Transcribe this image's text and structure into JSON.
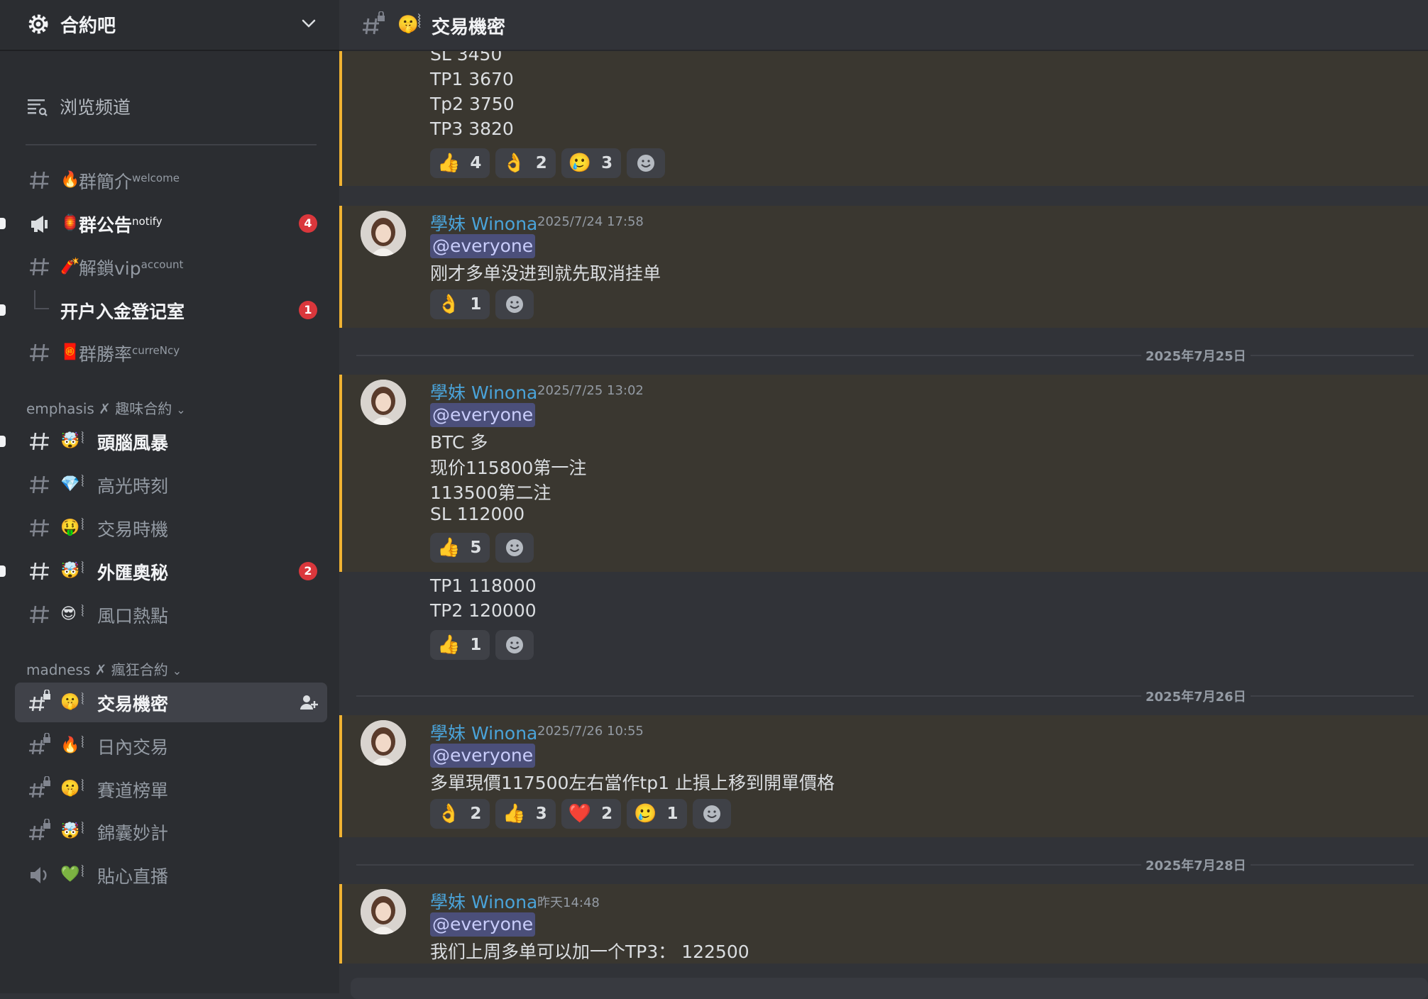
{
  "server": {
    "name": "合約吧"
  },
  "browse": {
    "label": "浏览频道"
  },
  "channels_top": [
    {
      "emoji": "🔥",
      "name": "群簡介",
      "sup": "welcome"
    },
    {
      "emoji": "🏮",
      "name": "群公告",
      "sup": "notify",
      "badge": "4"
    },
    {
      "emoji": "🧨",
      "name": "解鎖vip",
      "sup": "account"
    },
    {
      "name": "开户入金登记室",
      "badge": "1"
    },
    {
      "emoji": "🧧",
      "name": "群勝率",
      "sup": "curreNcy"
    }
  ],
  "category1": {
    "label": "emphasis ✗ 趣味合約"
  },
  "channels_cat1": [
    {
      "emoji": "🤯",
      "name": "頭腦風暴"
    },
    {
      "emoji": "💎",
      "name": "高光時刻"
    },
    {
      "emoji": "🤑",
      "name": "交易時機"
    },
    {
      "emoji": "🤯",
      "name": "外匯奧秘",
      "badge": "2"
    },
    {
      "emoji": "😎",
      "name": "風口熱點"
    }
  ],
  "category2": {
    "label": "madness ✗ 瘋狂合約"
  },
  "channels_cat2": [
    {
      "emoji": "🤫",
      "name": "交易機密"
    },
    {
      "emoji": "🔥",
      "name": "日內交易"
    },
    {
      "emoji": "🤫",
      "name": "賽道榜單"
    },
    {
      "emoji": "🤯",
      "name": "錦囊妙計"
    },
    {
      "emoji": "💚",
      "name": "貼心直播"
    }
  ],
  "header": {
    "emoji": "🤫",
    "sep": "⦚",
    "title": "交易機密"
  },
  "sep_glyph": "⦚",
  "msg0": {
    "lines": [
      "SL 3450",
      "TP1 3670",
      "Tp2 3750",
      "TP3 3820"
    ],
    "reactions": [
      {
        "e": "👍",
        "n": "4"
      },
      {
        "e": "👌",
        "n": "2"
      },
      {
        "e": "🥲",
        "n": "3"
      }
    ]
  },
  "msg1": {
    "author": "學妹 Winona",
    "time": "2025/7/24 17:58",
    "mention": "@everyone",
    "text": "刚才多单没进到就先取消挂单",
    "reactions": [
      {
        "e": "👌",
        "n": "1"
      }
    ]
  },
  "date1": "2025年7月25日",
  "msg2": {
    "author": "學妹 Winona",
    "time": "2025/7/25 13:02",
    "mention": "@everyone",
    "lines": [
      "BTC 多",
      "现价115800第一注",
      "113500第二注",
      "SL 112000"
    ],
    "reactions": [
      {
        "e": "👍",
        "n": "5"
      }
    ]
  },
  "msg2b": {
    "lines": [
      "TP1 118000",
      "TP2 120000"
    ],
    "reactions": [
      {
        "e": "👍",
        "n": "1"
      }
    ]
  },
  "date2": "2025年7月26日",
  "msg3": {
    "author": "學妹 Winona",
    "time": "2025/7/26 10:55",
    "mention": "@everyone",
    "text": "多單現價117500左右當作tp1 止損上移到開單價格",
    "reactions": [
      {
        "e": "👌",
        "n": "2"
      },
      {
        "e": "👍",
        "n": "3"
      },
      {
        "e": "❤️",
        "n": "2"
      },
      {
        "e": "🥲",
        "n": "1"
      }
    ]
  },
  "date3": "2025年7月28日",
  "msg4": {
    "author": "學妹 Winona",
    "time": "昨天14:48",
    "mention": "@everyone",
    "text": "我们上周多单可以加一个TP3： 122500"
  },
  "colors": {
    "accent": "#f0b232",
    "author": "#4aa3d9",
    "badge": "#da373c",
    "mention_bg": "#4b4f7a"
  }
}
